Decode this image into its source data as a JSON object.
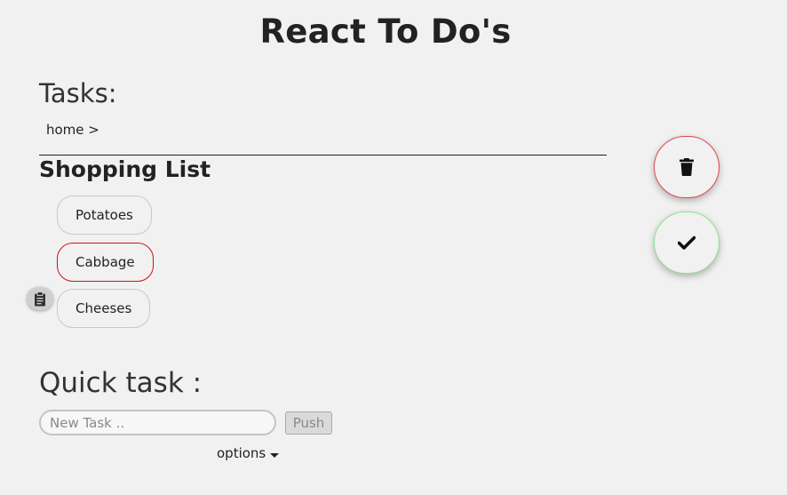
{
  "app": {
    "title": "React To Do's"
  },
  "tasks": {
    "heading": "Tasks:",
    "breadcrumb": "home >",
    "list_title": "Shopping List",
    "items": [
      {
        "label": "Potatoes",
        "selected": false
      },
      {
        "label": "Cabbage",
        "selected": true
      },
      {
        "label": "Cheeses",
        "selected": false
      }
    ],
    "item_icon": "clipboard-icon"
  },
  "actions": {
    "delete_icon": "trash-icon",
    "done_icon": "check-icon",
    "delete_accent": "#e04a4a",
    "done_accent": "#8ee28e"
  },
  "quick_task": {
    "heading": "Quick task :",
    "input_placeholder": "New Task ..",
    "input_value": "",
    "push_label": "Push",
    "options_label": "options"
  },
  "colors": {
    "background": "#f1f1f1",
    "selected_border": "#d0101a"
  }
}
